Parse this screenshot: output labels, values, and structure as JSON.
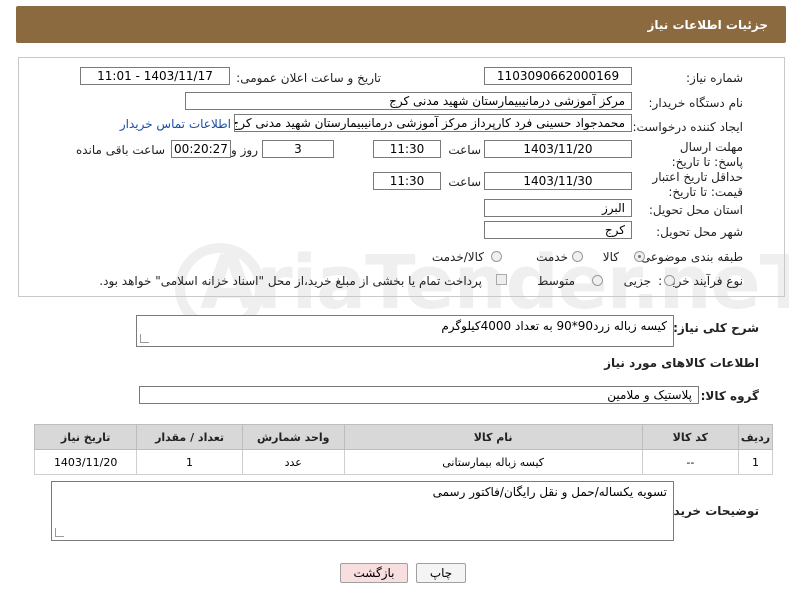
{
  "header": {
    "title": "جزئیات اطلاعات نیاز"
  },
  "form": {
    "need_number_label": "شماره نیاز:",
    "need_number": "1103090662000169",
    "announce_label": "تاریخ و ساعت اعلان عمومی:",
    "announce_value": "1403/11/17 - 11:01",
    "buyer_org_label": "نام دستگاه خریدار:",
    "buyer_org": "مرکز آموزشی درمانیبیمارستان شهید مدنی کرج",
    "creator_label": "ایجاد کننده درخواست:",
    "creator": "محمدجواد حسینی فرد کارپرداز مرکز آموزشی درمانیبیمارستان شهید مدنی کرج",
    "contact_link": "اطلاعات تماس خریدار",
    "deadline_label": "مهلت ارسال پاسخ: تا تاریخ:",
    "deadline_date": "1403/11/20",
    "time_label": "ساعت",
    "deadline_time": "11:30",
    "days_value": "3",
    "days_label": "روز و",
    "remaining_time": "00:20:27",
    "remaining_label": "ساعت باقی مانده",
    "validity_label": "حداقل تاریخ اعتبار قیمت: تا تاریخ:",
    "validity_date": "1403/11/30",
    "validity_time": "11:30",
    "province_label": "استان محل تحویل:",
    "province": "البرز",
    "city_label": "شهر محل تحویل:",
    "city": "کرج",
    "category_label": "طبقه بندی موضوعی:",
    "category_options": [
      "کالا",
      "خدمت",
      "کالا/خدمت"
    ],
    "purchase_type_label": "نوع فرآیند خرید :",
    "purchase_options": [
      "جزیی",
      "متوسط"
    ],
    "payment_note": "پرداخت تمام یا بخشی از مبلغ خرید،از محل \"اسناد خزانه اسلامی\" خواهد بود."
  },
  "summary": {
    "label": "شرح کلی نیاز:",
    "text": "کیسه زباله زرد90*90 به تعداد 4000کیلوگرم"
  },
  "goods": {
    "section_title": "اطلاعات کالاهای مورد نیاز",
    "group_label": "گروه کالا:",
    "group_value": "پلاستیک و ملامین",
    "columns": [
      "ردیف",
      "کد کالا",
      "نام کالا",
      "واحد شمارش",
      "تعداد / مقدار",
      "تاریخ نیاز"
    ],
    "rows": [
      {
        "index": "1",
        "code": "--",
        "name": "کیسه زباله بیمارستانی",
        "unit": "عدد",
        "qty": "1",
        "date": "1403/11/20"
      }
    ]
  },
  "notes": {
    "label": "توضیحات خریدار:",
    "text": "تسویه یکساله/حمل و نقل رایگان/فاکتور رسمی"
  },
  "buttons": {
    "print": "چاپ",
    "back": "بازگشت"
  },
  "watermark": {
    "text": "AriaTender.neT"
  },
  "colors": {
    "header_bg": "#8c6a3f",
    "link": "#1a4fa0",
    "back_button_bg": "#f8dede"
  }
}
